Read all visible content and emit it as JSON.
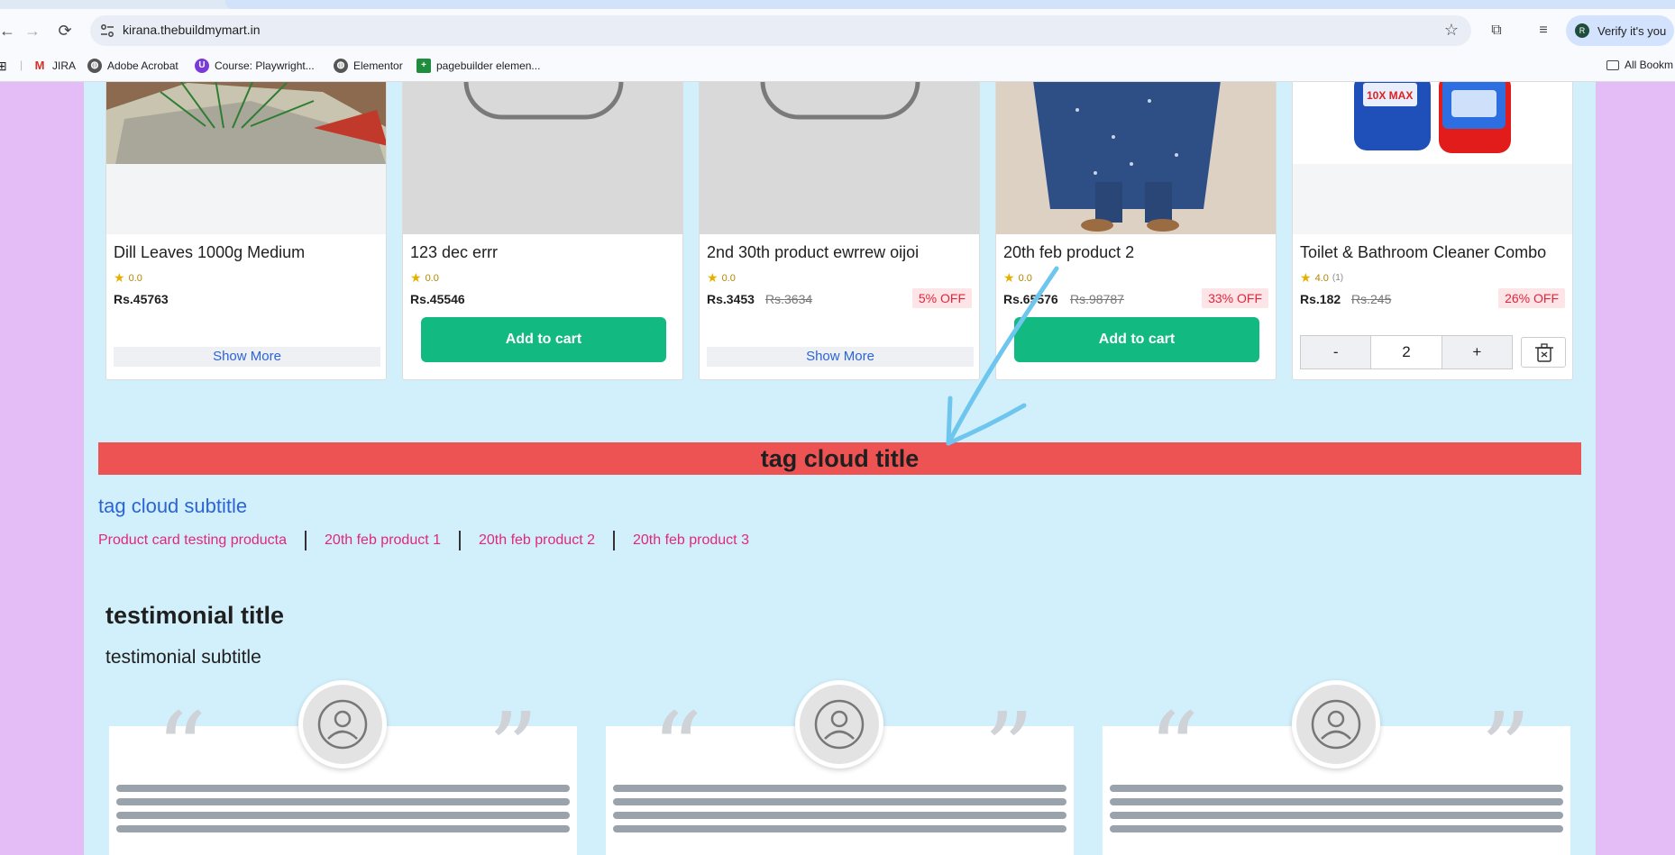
{
  "browser": {
    "url": "kirana.thebuildmymart.in",
    "verify_label": "Verify it's you",
    "profile_initial": "R",
    "bookmarks": [
      {
        "label": "JIRA",
        "icon": "gmail-icon"
      },
      {
        "label": "Adobe Acrobat",
        "icon": "globe-icon"
      },
      {
        "label": "Course: Playwright...",
        "icon": "course-icon"
      },
      {
        "label": "Elementor",
        "icon": "globe-icon"
      },
      {
        "label": "pagebuilder elemen...",
        "icon": "sheets-icon"
      }
    ],
    "all_bookmarks": "All Bookm"
  },
  "products": [
    {
      "name": "Dill Leaves 1000g Medium",
      "rating": "0.0",
      "price": "Rs.45763",
      "action": "Show More"
    },
    {
      "name": "123 dec errr",
      "rating": "0.0",
      "price": "Rs.45546",
      "action": "Add to cart"
    },
    {
      "name": "2nd 30th product ewrrew oijoi",
      "rating": "0.0",
      "price": "Rs.3453",
      "mrp": "Rs.3634",
      "off": "5% OFF",
      "action": "Show More"
    },
    {
      "name": "20th feb product 2",
      "rating": "0.0",
      "price": "Rs.65576",
      "mrp": "Rs.98787",
      "off": "33% OFF",
      "action": "Add to cart"
    },
    {
      "name": "Toilet & Bathroom Cleaner Combo",
      "rating": "4.0",
      "rating_count": "(1)",
      "price": "Rs.182",
      "mrp": "Rs.245",
      "off": "26% OFF",
      "qty_minus": "-",
      "qty": "2",
      "qty_plus": "+"
    }
  ],
  "tag_cloud": {
    "title": "tag cloud title",
    "subtitle": "tag cloud subtitle",
    "tags": [
      "Product card testing producta",
      "20th feb product 1",
      "20th feb product 2",
      "20th feb product 3"
    ]
  },
  "testimonials": {
    "title": "testimonial title",
    "subtitle": "testimonial subtitle"
  },
  "colors": {
    "page_bg": "#d2f0fb",
    "outer_bg": "#e4bdf7",
    "tag_title_bg": "#ee5353",
    "cart_button": "#12b981",
    "tag_link": "#e0287a",
    "discount": "#e0263d",
    "annotation_arrow": "#6ec6ef"
  }
}
